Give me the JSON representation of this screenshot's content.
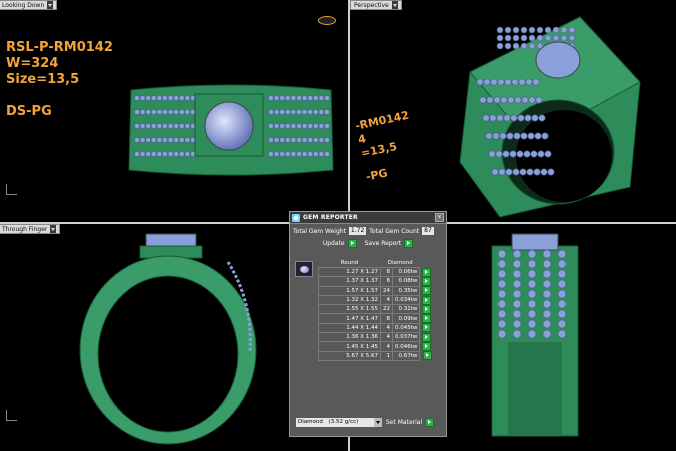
{
  "viewports": {
    "top_left": {
      "label": "Looking Down",
      "text_lines": [
        "RSL-P-RM0142",
        "W=324",
        "Size=13,5",
        "",
        "DS-PG"
      ]
    },
    "top_right": {
      "label": "Perspective",
      "text_lines": [
        "-RM0142",
        "4",
        "=13,5",
        "",
        "-PG"
      ]
    },
    "bottom_left": {
      "label": "Through Finger"
    },
    "bottom_right": {
      "label": ""
    }
  },
  "colors": {
    "metal": "#2e8b5a",
    "gem": "#8aa0d8",
    "text": "#f2a33b",
    "panel": "#595959"
  },
  "gem_reporter": {
    "title": "GEM REPORTER",
    "total_weight_label": "Total Gem Weight",
    "total_weight": "1.72",
    "total_count_label": "Total Gem Count",
    "total_count": "87",
    "update_label": "Update",
    "save_label": "Save Report",
    "col_shape": "Round",
    "col_material": "Diamond",
    "rows": [
      {
        "size": "1.27 X 1.27",
        "count": "8",
        "weight": "0.06tw"
      },
      {
        "size": "1.37 X 1.37",
        "count": "8",
        "weight": "0.08tw"
      },
      {
        "size": "1.57 X 1.57",
        "count": "24",
        "weight": "0.35tw"
      },
      {
        "size": "1.32 X 1.32",
        "count": "4",
        "weight": "0.034tw"
      },
      {
        "size": "1.55 X 1.55",
        "count": "22",
        "weight": "0.31tw"
      },
      {
        "size": "1.47 X 1.47",
        "count": "8",
        "weight": "0.09tw"
      },
      {
        "size": "1.44 X 1.44",
        "count": "4",
        "weight": "0.045tw"
      },
      {
        "size": "1.36 X 1.36",
        "count": "4",
        "weight": "0.037tw"
      },
      {
        "size": "1.45 X 1.45",
        "count": "4",
        "weight": "0.046tw"
      },
      {
        "size": "5.67 X 5.67",
        "count": "1",
        "weight": "0.67tw"
      }
    ],
    "material_select": "Diamond",
    "material_density": "(3.52 g/cc)",
    "set_material_label": "Set Material"
  }
}
